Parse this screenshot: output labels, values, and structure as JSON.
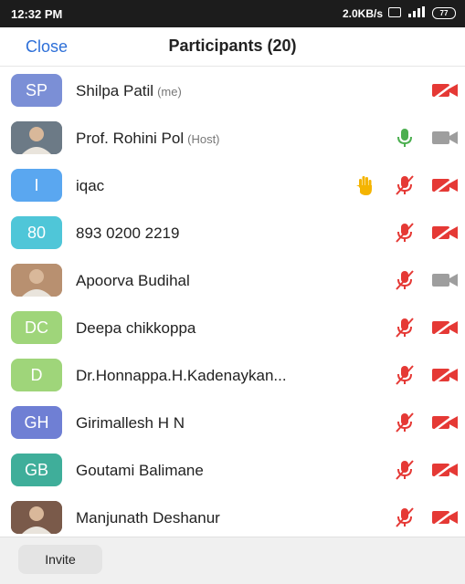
{
  "status": {
    "time": "12:32 PM",
    "speed": "2.0KB/s",
    "battery": "77"
  },
  "header": {
    "close_label": "Close",
    "title": "Participants (20)"
  },
  "participants": [
    {
      "initials": "SP",
      "name": "Shilpa Patil",
      "tag": "(me)",
      "color": "#7b8fd6",
      "mic": "none",
      "cam": "off",
      "hand": false,
      "photo": false
    },
    {
      "initials": "",
      "name": "Prof. Rohini Pol",
      "tag": "(Host)",
      "color": "#6c7a86",
      "mic": "on",
      "cam": "on",
      "hand": false,
      "photo": true
    },
    {
      "initials": "I",
      "name": "iqac",
      "tag": "",
      "color": "#5aa7f0",
      "mic": "off",
      "cam": "off",
      "hand": true,
      "photo": false
    },
    {
      "initials": "80",
      "name": "893 0200 2219",
      "tag": "",
      "color": "#4fc6d8",
      "mic": "off",
      "cam": "off",
      "hand": false,
      "photo": false
    },
    {
      "initials": "",
      "name": "Apoorva Budihal",
      "tag": "",
      "color": "#b89070",
      "mic": "off",
      "cam": "on",
      "hand": false,
      "photo": true
    },
    {
      "initials": "DC",
      "name": "Deepa chikkoppa",
      "tag": "",
      "color": "#9fd57a",
      "mic": "off",
      "cam": "off",
      "hand": false,
      "photo": false
    },
    {
      "initials": "D",
      "name": "Dr.Honnappa.H.Kadenaykan...",
      "tag": "",
      "color": "#9fd57a",
      "mic": "off",
      "cam": "off",
      "hand": false,
      "photo": false
    },
    {
      "initials": "GH",
      "name": "Girimallesh H N",
      "tag": "",
      "color": "#6f7fd4",
      "mic": "off",
      "cam": "off",
      "hand": false,
      "photo": false
    },
    {
      "initials": "GB",
      "name": "Goutami Balimane",
      "tag": "",
      "color": "#3fae9a",
      "mic": "off",
      "cam": "off",
      "hand": false,
      "photo": false
    },
    {
      "initials": "",
      "name": "Manjunath Deshanur",
      "tag": "",
      "color": "#7a5a4a",
      "mic": "off",
      "cam": "off",
      "hand": false,
      "photo": true
    }
  ],
  "footer": {
    "invite_label": "Invite"
  },
  "colors": {
    "accent": "#2d6fd8",
    "muted_red": "#e53935",
    "mic_green": "#4caf50",
    "cam_gray": "#9e9e9e",
    "hand": "#f4b400"
  }
}
